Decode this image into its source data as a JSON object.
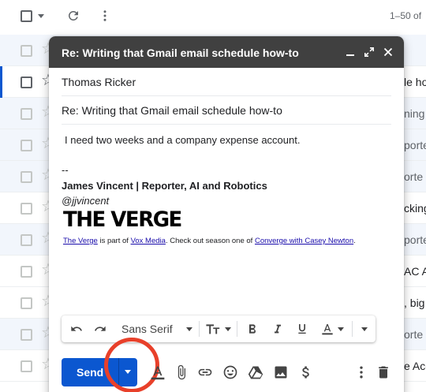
{
  "inbox": {
    "pager_text": "1–50 of",
    "rows": [
      {
        "text": ""
      },
      {
        "text": "le ho"
      },
      {
        "text": "ning a"
      },
      {
        "text": "porte"
      },
      {
        "text": "orte"
      },
      {
        "text": "cking"
      },
      {
        "text": "porte"
      },
      {
        "text": "AC AI"
      },
      {
        "text": ", big"
      },
      {
        "text": "orte"
      },
      {
        "text": "e Acc"
      }
    ]
  },
  "compose": {
    "title": "Re: Writing that Gmail email schedule how-to",
    "to": "Thomas Ricker",
    "subject": "Re: Writing that Gmail email schedule how-to",
    "message": "I need two weeks and a company expense account.",
    "signature": {
      "dash": "--",
      "name": "James Vincent | Reporter, AI and Robotics",
      "handle": "@jjvincent",
      "logo_text": "THE VERGE",
      "footer_link1": "The Verge",
      "footer_text1": " is part of ",
      "footer_link2": "Vox Media",
      "footer_text2": ". Check out season one of ",
      "footer_link3": "Converge with Casey Newton",
      "footer_text3": "."
    },
    "toolbar": {
      "font_name": "Sans Serif",
      "icons": [
        "undo-icon",
        "redo-icon",
        "text-size-icon",
        "bold-icon",
        "italic-icon",
        "underline-icon",
        "text-color-icon",
        "more-formatting-icon"
      ]
    },
    "send_label": "Send",
    "actions": [
      "formatting-options-icon",
      "attach-icon",
      "link-icon",
      "emoji-icon",
      "drive-icon",
      "photo-icon",
      "money-icon",
      "more-options-icon",
      "discard-icon"
    ]
  },
  "colors": {
    "header_bg": "#404040",
    "send_blue": "#0b57d0",
    "highlight_circle": "#e8402a"
  }
}
